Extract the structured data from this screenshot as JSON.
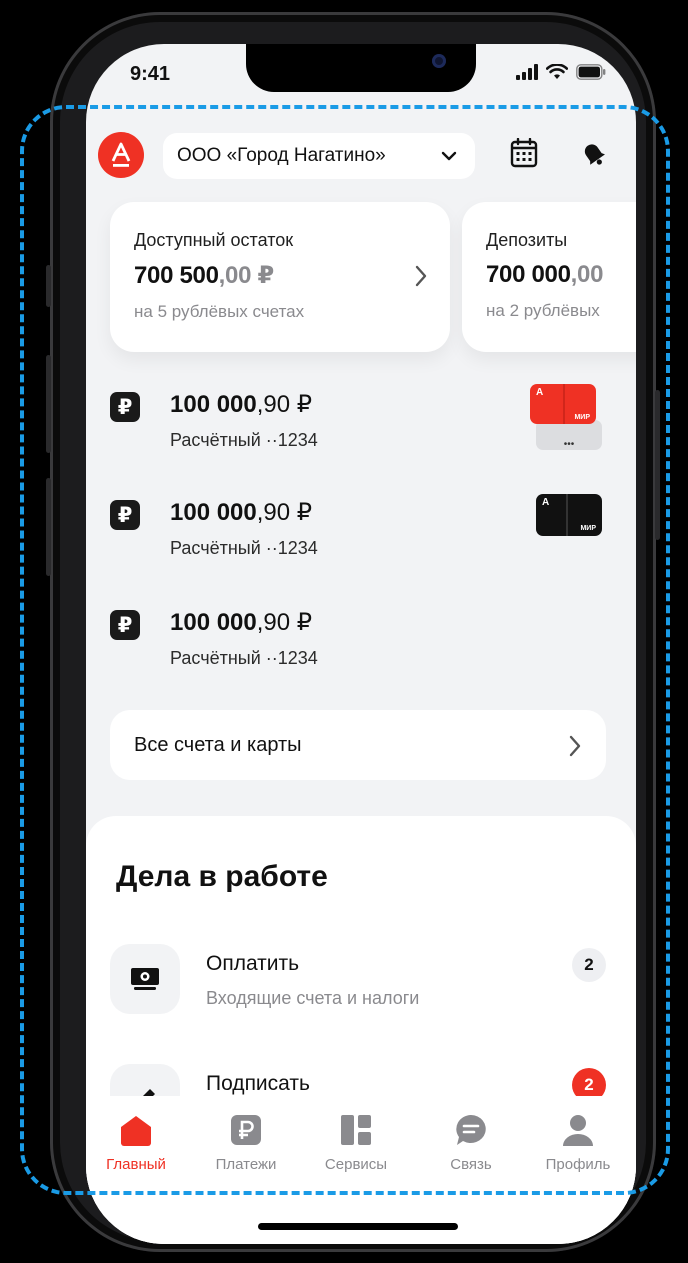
{
  "status": {
    "time": "9:41"
  },
  "header": {
    "logo_letter": "А",
    "company_name": "ООО «Город Нагатино»"
  },
  "balance_cards": [
    {
      "label": "Доступный остаток",
      "amount_main": "700 500",
      "amount_cents": ",00 ₽",
      "subtitle": "на 5 рублёвых счетах"
    },
    {
      "label": "Депозиты",
      "amount_main": "700 000",
      "amount_cents": ",00",
      "subtitle": "на 2 рублёвых"
    }
  ],
  "accounts": [
    {
      "amount_main": "100 000",
      "amount_rest": ",90 ₽",
      "subtitle": "Расчётный ··1234",
      "card": "red-stack"
    },
    {
      "amount_main": "100 000",
      "amount_rest": ",90 ₽",
      "subtitle": "Расчётный ··1234",
      "card": "black"
    },
    {
      "amount_main": "100 000",
      "amount_rest": ",90 ₽",
      "subtitle": "Расчётный ··1234",
      "card": "none"
    }
  ],
  "card_labels": {
    "brand_letter": "А",
    "network": "МИР",
    "more": "•••"
  },
  "all_accounts_label": "Все счета и карты",
  "todo": {
    "title": "Дела в работе",
    "tasks": [
      {
        "title": "Оплатить",
        "subtitle": "Входящие счета и налоги",
        "badge": "2",
        "badge_color": "#eeeff2",
        "badge_text_color": "#111111"
      },
      {
        "title": "Подписать",
        "subtitle": "",
        "badge": "2",
        "badge_color": "#ef3124",
        "badge_text_color": "#ffffff"
      }
    ]
  },
  "tabs": [
    {
      "label": "Главный",
      "icon": "home-icon",
      "active": true
    },
    {
      "label": "Платежи",
      "icon": "ruble-icon",
      "active": false
    },
    {
      "label": "Сервисы",
      "icon": "grid-icon",
      "active": false
    },
    {
      "label": "Связь",
      "icon": "chat-icon",
      "active": false
    },
    {
      "label": "Профиль",
      "icon": "profile-icon",
      "active": false
    }
  ],
  "colors": {
    "accent": "#ef3124",
    "selection_outline": "#1a9be6",
    "background": "#f2f3f5"
  }
}
